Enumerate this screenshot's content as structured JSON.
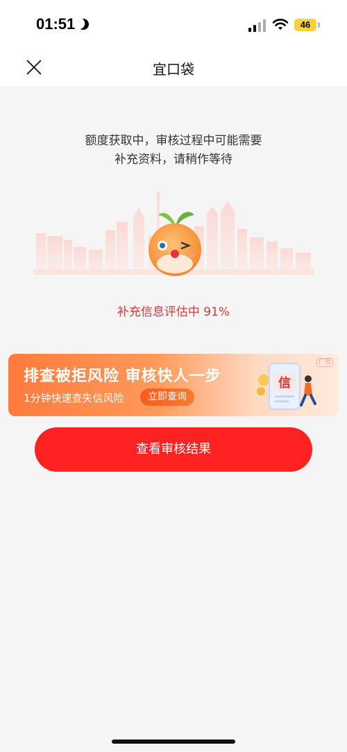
{
  "status_bar": {
    "time": "01:51",
    "battery": "46",
    "battery_color": "#f6d33b"
  },
  "nav": {
    "title": "宜口袋",
    "close_icon": "close-icon"
  },
  "notice": {
    "line1": "额度获取中，审核过程中可能需要",
    "line2": "补充资料，请稍作等待"
  },
  "progress": {
    "text": "补充信息评估中 91%",
    "percent": 91,
    "color": "#d9383a"
  },
  "ad_banner": {
    "tag": "广告",
    "title": "排查被拒风险  审核快人一步",
    "subtitle": "1分钟快速查失信风险",
    "button_label": "立即查询",
    "art_char": "信"
  },
  "main_button": {
    "label": "查看审核结果",
    "color": "#fe2222"
  }
}
